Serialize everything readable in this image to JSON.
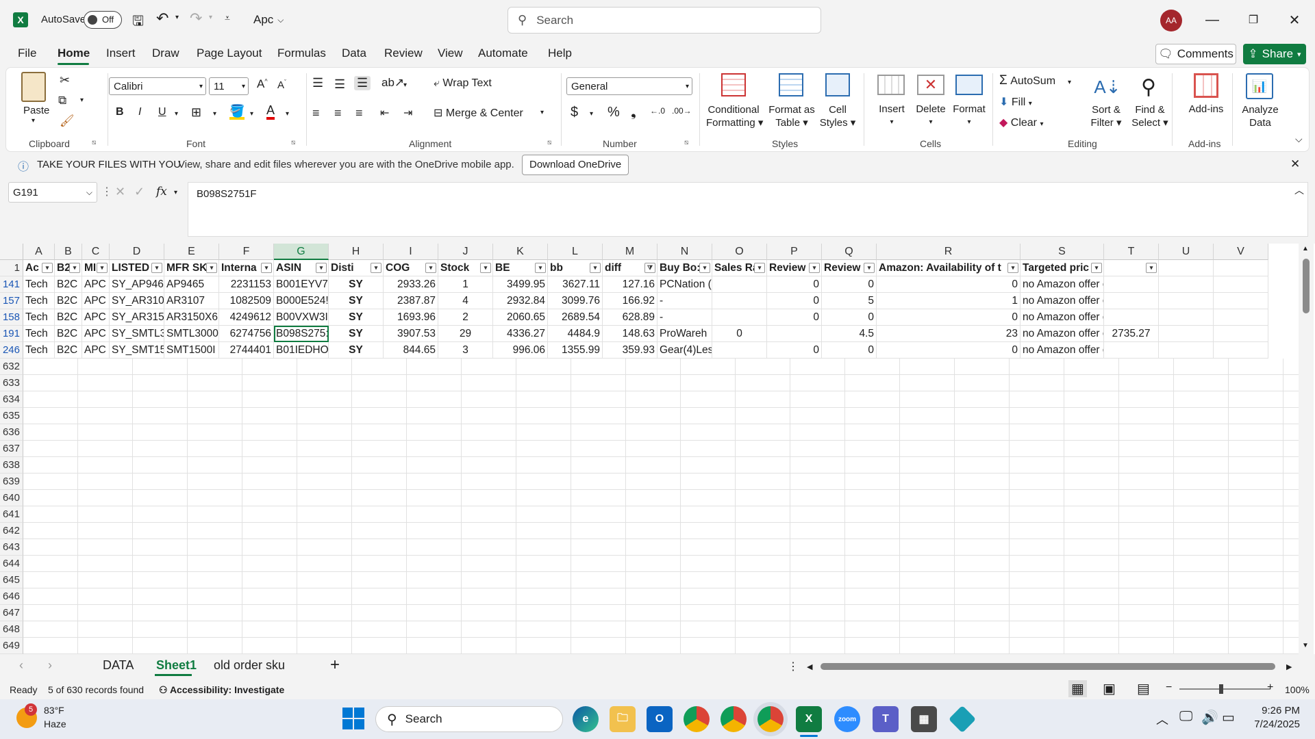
{
  "titlebar": {
    "autosave_label": "AutoSave",
    "autosave_state": "Off",
    "filename": "Apc",
    "search_placeholder": "Search",
    "avatar_initials": "AA"
  },
  "menu": {
    "items": [
      "File",
      "Home",
      "Insert",
      "Draw",
      "Page Layout",
      "Formulas",
      "Data",
      "Review",
      "View",
      "Automate",
      "Help"
    ],
    "comments": "Comments",
    "share": "Share"
  },
  "ribbon": {
    "clipboard": {
      "paste": "Paste",
      "label": "Clipboard"
    },
    "font": {
      "name": "Calibri",
      "size": "11",
      "label": "Font"
    },
    "alignment": {
      "wrap": "Wrap Text",
      "merge": "Merge & Center",
      "label": "Alignment"
    },
    "number": {
      "format": "General",
      "label": "Number"
    },
    "styles": {
      "cond1": "Conditional",
      "cond2": "Formatting",
      "table1": "Format as",
      "table2": "Table",
      "cell1": "Cell",
      "cell2": "Styles",
      "label": "Styles"
    },
    "cells": {
      "insert": "Insert",
      "delete": "Delete",
      "format": "Format",
      "label": "Cells"
    },
    "editing": {
      "autosum": "AutoSum",
      "fill": "Fill",
      "clear": "Clear",
      "sort1": "Sort &",
      "sort2": "Filter",
      "find1": "Find &",
      "find2": "Select",
      "label": "Editing"
    },
    "addins": {
      "addins": "Add-ins",
      "label": "Add-ins"
    },
    "analyze": {
      "l1": "Analyze",
      "l2": "Data"
    }
  },
  "infobar": {
    "title": "TAKE YOUR FILES WITH YOU",
    "message": "View, share and edit files wherever you are with the OneDrive mobile app.",
    "button": "Download OneDrive"
  },
  "formula": {
    "namebox": "G191",
    "fx": "fx",
    "content": "B098S2751F"
  },
  "columns": [
    "A",
    "B",
    "C",
    "D",
    "E",
    "F",
    "G",
    "H",
    "I",
    "J",
    "K",
    "L",
    "M",
    "N",
    "O",
    "P",
    "Q",
    "R",
    "S",
    "T",
    "U",
    "V"
  ],
  "header_row": {
    "num": "1",
    "cells": [
      "Ac",
      "B2",
      "MI",
      "LISTED",
      "MFR SK",
      "Interna",
      "ASIN",
      "Disti",
      "COG",
      "Stock",
      "BE",
      "bb",
      "diff",
      "Buy Bo:",
      "Sales Ra",
      "Review",
      "Review",
      "Amazon: Availability of t",
      "Targeted pric",
      ""
    ]
  },
  "rows": [
    {
      "num": "141",
      "cells": [
        "Tech",
        "B2C",
        "APC",
        "SY_AP946!",
        "AP9465",
        "2231153",
        "B001EYV7.",
        "SY",
        "2933.26",
        "1",
        "3499.95",
        "3627.11",
        "127.16",
        "PCNation (",
        "",
        "0",
        "0",
        "0",
        "no Amazon offer exists",
        ""
      ]
    },
    {
      "num": "157",
      "cells": [
        "Tech",
        "B2C",
        "APC",
        "SY_AR310",
        "AR3107",
        "1082509",
        "B000E524!",
        "SY",
        "2387.87",
        "4",
        "2932.84",
        "3099.76",
        "166.92",
        "-",
        "",
        "0",
        "5",
        "1",
        "no Amazon offer exists",
        ""
      ]
    },
    {
      "num": "158",
      "cells": [
        "Tech",
        "B2C",
        "APC",
        "SY_AR315(",
        "AR3150X6",
        "4249612",
        "B00VXW3I",
        "SY",
        "1693.96",
        "2",
        "2060.65",
        "2689.54",
        "628.89",
        "-",
        "",
        "0",
        "0",
        "0",
        "no Amazon offer exists",
        ""
      ]
    },
    {
      "num": "191",
      "cells": [
        "Tech",
        "B2C",
        "APC",
        "SY_SMTL3",
        "SMTL3000",
        "6274756",
        "B098S275:",
        "SY",
        "3907.53",
        "29",
        "4336.27",
        "4484.9",
        "148.63",
        "ProWareh",
        "0",
        "",
        "4.5",
        "23",
        "no Amazon offer exists",
        "2735.27"
      ]
    },
    {
      "num": "246",
      "cells": [
        "Tech",
        "B2C",
        "APC",
        "SY_SMT15",
        "SMT1500I",
        "2744401",
        "B01IEDHO",
        "SY",
        "844.65",
        "3",
        "996.06",
        "1355.99",
        "359.93",
        "Gear(4)Les",
        "",
        "0",
        "0",
        "0",
        "no Amazon offer exists",
        ""
      ]
    }
  ],
  "empty_rows": [
    "632",
    "633",
    "634",
    "635",
    "636",
    "637",
    "638",
    "639",
    "640",
    "641",
    "642",
    "643",
    "644",
    "645",
    "646",
    "647",
    "648",
    "649"
  ],
  "sheets": {
    "tabs": [
      "DATA",
      "Sheet1",
      "old order sku"
    ],
    "active": "Sheet1"
  },
  "status": {
    "ready": "Ready",
    "records": "5 of 630 records found",
    "accessibility": "Accessibility: Investigate",
    "zoom": "100%"
  },
  "taskbar": {
    "weather_temp": "83°F",
    "weather_desc": "Haze",
    "weather_badge": "5",
    "search": "Search",
    "time": "9:26 PM",
    "date": "7/24/2025"
  },
  "colors": {
    "excel_green": "#107c41",
    "row_header_filtered": "#1a56b5",
    "avatar": "#a4262c"
  }
}
